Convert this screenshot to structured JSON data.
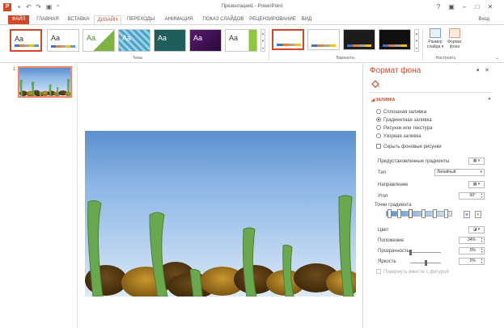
{
  "titlebar": {
    "app_logo": "P",
    "title": "Презентация1 - PowerPoint",
    "help": "?",
    "window_controls": [
      "–",
      "□",
      "✕"
    ]
  },
  "tabs": {
    "file": "ФАЙЛ",
    "home": "ГЛАВНАЯ",
    "insert": "ВСТАВКА",
    "design": "ДИЗАЙН",
    "transitions": "ПЕРЕХОДЫ",
    "animations": "АНИМАЦИЯ",
    "slideshow": "ПОКАЗ СЛАЙДОВ",
    "review": "РЕЦЕНЗИРОВАНИЕ",
    "view": "ВИД",
    "account": "Вход"
  },
  "ribbon": {
    "themes_label": "Темы",
    "variants_label": "Варианты",
    "customize_label": "Настроить",
    "theme_aa": "Aa",
    "slide_size": "Размер слайда ▾",
    "format_background": "Формат фона"
  },
  "thumbnails": {
    "slide_number": "1"
  },
  "pane": {
    "title": "Формат фона",
    "section_fill": "ЗАЛИВКА",
    "fill_options": [
      "Сплошная заливка",
      "Градиентная заливка",
      "Рисунок или текстура",
      "Узорная заливка"
    ],
    "selected_fill_index": 1,
    "hide_background": "Скрыть фоновые рисунки",
    "preset_gradients": "Предустановленные градиенты",
    "type_label": "Тип",
    "type_value": "Линейный",
    "direction_label": "Направление",
    "angle_label": "Угол",
    "angle_value": "90°",
    "gradient_stops_label": "Точки градиента",
    "color_label": "Цвет",
    "position_label": "Положение:",
    "position_value": "34%",
    "transparency_label": "Прозрачность",
    "transparency_value": "0%",
    "transparency_level_percent": 0,
    "brightness_label": "Яркость",
    "brightness_value": "0%",
    "brightness_level_percent": 0,
    "rotate_with_shape": "Повернуть вместе с фигурой"
  },
  "colors": {
    "accent": "#d24726",
    "sky_top": "#5b8fcf",
    "sky_bottom": "#dbe9f7",
    "seaweed": "#6aa84f",
    "stone_dark": "#4e3410",
    "stone_light": "#b8892b"
  }
}
